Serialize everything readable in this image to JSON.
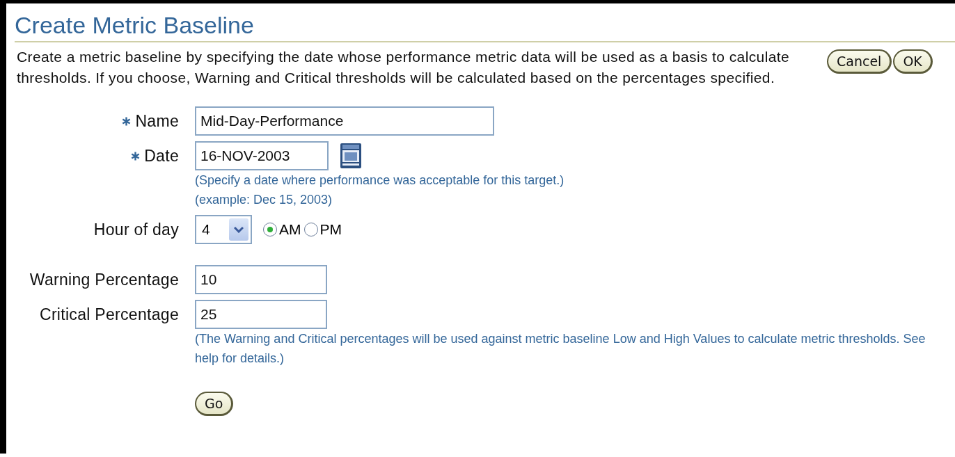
{
  "title": "Create Metric Baseline",
  "description": "Create a metric baseline by specifying the date whose performance metric data will be used as a basis to calculate thresholds. If you choose, Warning and Critical thresholds will be calculated based on the percentages specified.",
  "buttons": [
    {
      "label": "Cancel"
    },
    {
      "label": "OK"
    }
  ],
  "sections": [
    {
      "fields": [
        {
          "kind": "text",
          "label": "Name",
          "required": true,
          "value": "Mid-Day-Performance"
        },
        {
          "kind": "date",
          "label": "Date",
          "required": true,
          "value": "16-NOV-2003",
          "hints": [
            "(Specify a date where performance was acceptable for this target.)",
            "(example: Dec 15, 2003)"
          ]
        },
        {
          "kind": "hour",
          "label": "Hour of day",
          "required": false,
          "value": "4",
          "options": [
            {
              "label": "AM",
              "selected": true
            },
            {
              "label": "PM",
              "selected": false
            }
          ]
        }
      ]
    },
    {
      "fields": [
        {
          "kind": "number",
          "label": "Warning Percentage",
          "required": false,
          "value": "10"
        },
        {
          "kind": "number",
          "label": "Critical Percentage",
          "required": false,
          "value": "25",
          "hints": [
            "(The Warning and Critical percentages will be used against metric baseline Low and High Values to calculate metric thresholds. See help for details.)"
          ]
        }
      ]
    }
  ],
  "go_button": "Go"
}
